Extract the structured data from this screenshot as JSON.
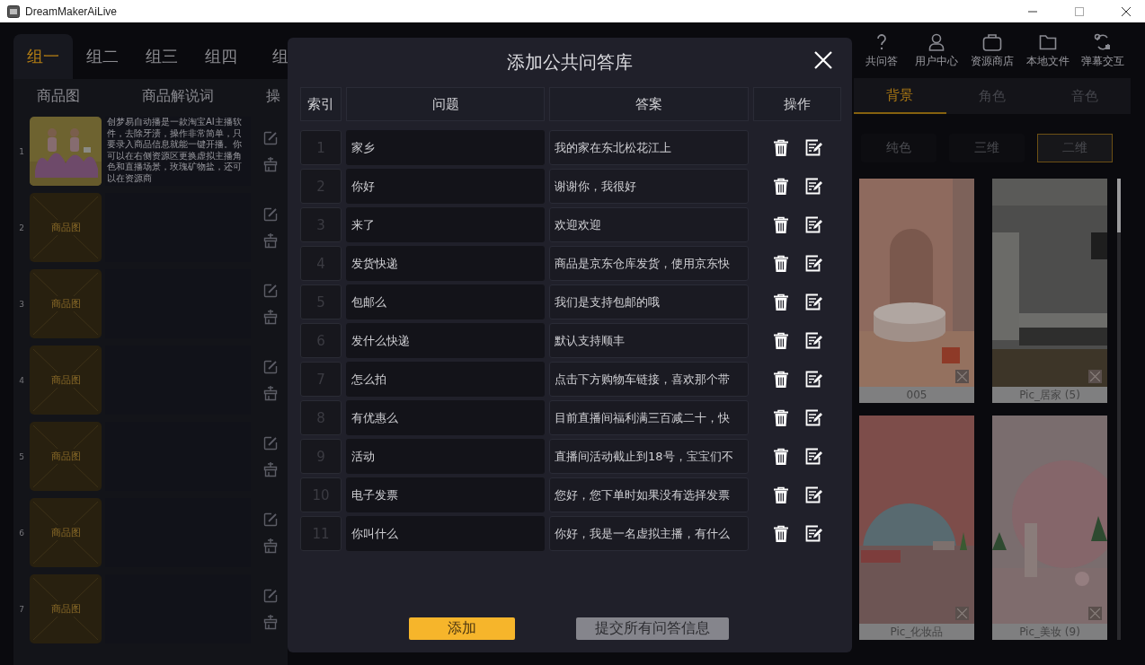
{
  "window": {
    "title": "DreamMakerAiLive"
  },
  "product_panel": {
    "tabs": [
      {
        "label": "组一",
        "selected": true
      },
      {
        "label": "组二",
        "selected": false
      },
      {
        "label": "组三",
        "selected": false
      },
      {
        "label": "组四",
        "selected": false
      },
      {
        "label": "组",
        "selected": false
      }
    ],
    "columns": [
      "商品图",
      "商品解说词",
      "操"
    ],
    "rows": [
      {
        "index": "1",
        "kind": "picture",
        "description": "创梦易自动播是一款淘宝AI主播软件，去除牙渍，操作非常简单，只要录入商品信息就能一键开播。你可以在右侧资源区更换虚拟主播角色和直播场景，玫瑰矿物盐，还可以在资源商"
      },
      {
        "index": "2",
        "kind": "placeholder",
        "image_label": "商品图"
      },
      {
        "index": "3",
        "kind": "placeholder",
        "image_label": "商品图"
      },
      {
        "index": "4",
        "kind": "placeholder",
        "image_label": "商品图"
      },
      {
        "index": "5",
        "kind": "placeholder",
        "image_label": "商品图"
      },
      {
        "index": "6",
        "kind": "placeholder",
        "image_label": "商品图"
      },
      {
        "index": "7",
        "kind": "placeholder",
        "image_label": "商品图"
      }
    ]
  },
  "toolbar": [
    {
      "label": "共问答"
    },
    {
      "label": "用户中心"
    },
    {
      "label": "资源商店"
    },
    {
      "label": "本地文件"
    },
    {
      "label": "弹幕交互"
    }
  ],
  "resource_tabs": [
    {
      "label": "背景",
      "selected": true
    },
    {
      "label": "角色",
      "selected": false
    },
    {
      "label": "音色",
      "selected": false
    }
  ],
  "background_types": [
    {
      "label": "纯色",
      "selected": false
    },
    {
      "label": "三维",
      "selected": false
    },
    {
      "label": "二维",
      "selected": true
    }
  ],
  "gallery": [
    {
      "label": "005"
    },
    {
      "label": "Pic_居家 (5)"
    },
    {
      "label": "Pic_化妆品"
    },
    {
      "label": "Pic_美妆 (9)"
    }
  ],
  "dialog": {
    "title": "添加公共问答库",
    "columns": [
      "索引",
      "问题",
      "答案",
      "操作"
    ],
    "rows": [
      {
        "index": "1",
        "question": "家乡",
        "answer": "我的家在东北松花江上"
      },
      {
        "index": "2",
        "question": "你好",
        "answer": "谢谢你，我很好"
      },
      {
        "index": "3",
        "question": "来了",
        "answer": "欢迎欢迎"
      },
      {
        "index": "4",
        "question": "发货快递",
        "answer": "商品是京东仓库发货，使用京东快"
      },
      {
        "index": "5",
        "question": "包邮么",
        "answer": "我们是支持包邮的哦"
      },
      {
        "index": "6",
        "question": "发什么快递",
        "answer": "默认支持顺丰"
      },
      {
        "index": "7",
        "question": "怎么拍",
        "answer": "点击下方购物车链接，喜欢那个带"
      },
      {
        "index": "8",
        "question": "有优惠么",
        "answer": "目前直播间福利满三百减二十，快"
      },
      {
        "index": "9",
        "question": "活动",
        "answer": "直播间活动截止到18号，宝宝们不"
      },
      {
        "index": "10",
        "question": "电子发票",
        "answer": "您好，您下单时如果没有选择发票"
      },
      {
        "index": "11",
        "question": "你叫什么",
        "answer": "你好，我是一名虚拟主播，有什么"
      }
    ],
    "buttons": [
      {
        "label": "添加",
        "kind": "primary"
      },
      {
        "label": "提交所有问答信息",
        "kind": "secondary"
      }
    ]
  }
}
